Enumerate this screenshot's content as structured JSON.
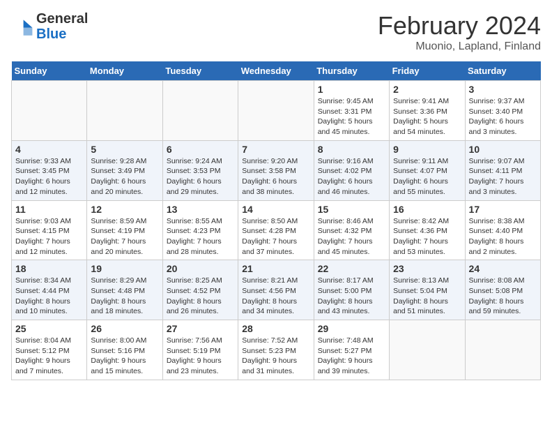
{
  "header": {
    "logo_general": "General",
    "logo_blue": "Blue",
    "month_title": "February 2024",
    "subtitle": "Muonio, Lapland, Finland"
  },
  "weekdays": [
    "Sunday",
    "Monday",
    "Tuesday",
    "Wednesday",
    "Thursday",
    "Friday",
    "Saturday"
  ],
  "weeks": [
    [
      {
        "day": "",
        "info": ""
      },
      {
        "day": "",
        "info": ""
      },
      {
        "day": "",
        "info": ""
      },
      {
        "day": "",
        "info": ""
      },
      {
        "day": "1",
        "info": "Sunrise: 9:45 AM\nSunset: 3:31 PM\nDaylight: 5 hours\nand 45 minutes."
      },
      {
        "day": "2",
        "info": "Sunrise: 9:41 AM\nSunset: 3:36 PM\nDaylight: 5 hours\nand 54 minutes."
      },
      {
        "day": "3",
        "info": "Sunrise: 9:37 AM\nSunset: 3:40 PM\nDaylight: 6 hours\nand 3 minutes."
      }
    ],
    [
      {
        "day": "4",
        "info": "Sunrise: 9:33 AM\nSunset: 3:45 PM\nDaylight: 6 hours\nand 12 minutes."
      },
      {
        "day": "5",
        "info": "Sunrise: 9:28 AM\nSunset: 3:49 PM\nDaylight: 6 hours\nand 20 minutes."
      },
      {
        "day": "6",
        "info": "Sunrise: 9:24 AM\nSunset: 3:53 PM\nDaylight: 6 hours\nand 29 minutes."
      },
      {
        "day": "7",
        "info": "Sunrise: 9:20 AM\nSunset: 3:58 PM\nDaylight: 6 hours\nand 38 minutes."
      },
      {
        "day": "8",
        "info": "Sunrise: 9:16 AM\nSunset: 4:02 PM\nDaylight: 6 hours\nand 46 minutes."
      },
      {
        "day": "9",
        "info": "Sunrise: 9:11 AM\nSunset: 4:07 PM\nDaylight: 6 hours\nand 55 minutes."
      },
      {
        "day": "10",
        "info": "Sunrise: 9:07 AM\nSunset: 4:11 PM\nDaylight: 7 hours\nand 3 minutes."
      }
    ],
    [
      {
        "day": "11",
        "info": "Sunrise: 9:03 AM\nSunset: 4:15 PM\nDaylight: 7 hours\nand 12 minutes."
      },
      {
        "day": "12",
        "info": "Sunrise: 8:59 AM\nSunset: 4:19 PM\nDaylight: 7 hours\nand 20 minutes."
      },
      {
        "day": "13",
        "info": "Sunrise: 8:55 AM\nSunset: 4:23 PM\nDaylight: 7 hours\nand 28 minutes."
      },
      {
        "day": "14",
        "info": "Sunrise: 8:50 AM\nSunset: 4:28 PM\nDaylight: 7 hours\nand 37 minutes."
      },
      {
        "day": "15",
        "info": "Sunrise: 8:46 AM\nSunset: 4:32 PM\nDaylight: 7 hours\nand 45 minutes."
      },
      {
        "day": "16",
        "info": "Sunrise: 8:42 AM\nSunset: 4:36 PM\nDaylight: 7 hours\nand 53 minutes."
      },
      {
        "day": "17",
        "info": "Sunrise: 8:38 AM\nSunset: 4:40 PM\nDaylight: 8 hours\nand 2 minutes."
      }
    ],
    [
      {
        "day": "18",
        "info": "Sunrise: 8:34 AM\nSunset: 4:44 PM\nDaylight: 8 hours\nand 10 minutes."
      },
      {
        "day": "19",
        "info": "Sunrise: 8:29 AM\nSunset: 4:48 PM\nDaylight: 8 hours\nand 18 minutes."
      },
      {
        "day": "20",
        "info": "Sunrise: 8:25 AM\nSunset: 4:52 PM\nDaylight: 8 hours\nand 26 minutes."
      },
      {
        "day": "21",
        "info": "Sunrise: 8:21 AM\nSunset: 4:56 PM\nDaylight: 8 hours\nand 34 minutes."
      },
      {
        "day": "22",
        "info": "Sunrise: 8:17 AM\nSunset: 5:00 PM\nDaylight: 8 hours\nand 43 minutes."
      },
      {
        "day": "23",
        "info": "Sunrise: 8:13 AM\nSunset: 5:04 PM\nDaylight: 8 hours\nand 51 minutes."
      },
      {
        "day": "24",
        "info": "Sunrise: 8:08 AM\nSunset: 5:08 PM\nDaylight: 8 hours\nand 59 minutes."
      }
    ],
    [
      {
        "day": "25",
        "info": "Sunrise: 8:04 AM\nSunset: 5:12 PM\nDaylight: 9 hours\nand 7 minutes."
      },
      {
        "day": "26",
        "info": "Sunrise: 8:00 AM\nSunset: 5:16 PM\nDaylight: 9 hours\nand 15 minutes."
      },
      {
        "day": "27",
        "info": "Sunrise: 7:56 AM\nSunset: 5:19 PM\nDaylight: 9 hours\nand 23 minutes."
      },
      {
        "day": "28",
        "info": "Sunrise: 7:52 AM\nSunset: 5:23 PM\nDaylight: 9 hours\nand 31 minutes."
      },
      {
        "day": "29",
        "info": "Sunrise: 7:48 AM\nSunset: 5:27 PM\nDaylight: 9 hours\nand 39 minutes."
      },
      {
        "day": "",
        "info": ""
      },
      {
        "day": "",
        "info": ""
      }
    ]
  ]
}
